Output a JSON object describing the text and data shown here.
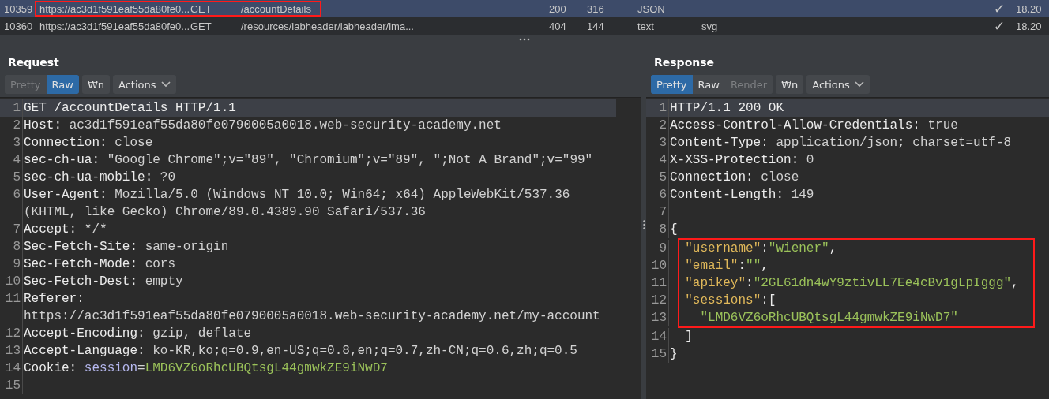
{
  "history": {
    "rows": [
      {
        "cells": [
          "10359",
          "https://ac3d1f591eaf55da80fe0...",
          "GET",
          "/accountDetails",
          "200",
          "316",
          "JSON",
          "",
          "✓",
          "18.20"
        ],
        "selected": true,
        "annotated": true
      },
      {
        "cells": [
          "10360",
          "https://ac3d1f591eaf55da80fe0...",
          "GET",
          "/resources/labheader/labheader/ima...",
          "404",
          "144",
          "text",
          "svg",
          "✓",
          "18.20"
        ],
        "selected": false,
        "annotated": false
      }
    ]
  },
  "panes": [
    {
      "title": "Request",
      "buttons": [
        {
          "label": "Pretty",
          "kind": "tab",
          "selected": false,
          "disabled": true
        },
        {
          "label": "Raw",
          "kind": "tab",
          "selected": true,
          "disabled": false
        },
        {
          "label": "₩n",
          "kind": "toggle",
          "selected": false,
          "disabled": false
        },
        {
          "label": "Actions",
          "kind": "menu",
          "selected": false,
          "disabled": false
        }
      ],
      "lines": [
        {
          "number": "1",
          "current": true,
          "annotated": false,
          "parts": [
            {
              "kind": "key",
              "text": "GET /accountDetails HTTP/1.1"
            }
          ]
        },
        {
          "number": "2",
          "current": false,
          "annotated": false,
          "parts": [
            {
              "kind": "key",
              "text": "Host: "
            },
            {
              "kind": "value",
              "text": "ac3d1f591eaf55da80fe0790005a0018.web-security-academy.net"
            }
          ]
        },
        {
          "number": "3",
          "current": false,
          "annotated": false,
          "parts": [
            {
              "kind": "key",
              "text": "Connection: "
            },
            {
              "kind": "value",
              "text": "close"
            }
          ]
        },
        {
          "number": "4",
          "current": false,
          "annotated": false,
          "parts": [
            {
              "kind": "key",
              "text": "sec-ch-ua: "
            },
            {
              "kind": "value",
              "text": "\"Google Chrome\";v=\"89\", \"Chromium\";v=\"89\", \";Not A Brand\";v=\"99\""
            }
          ]
        },
        {
          "number": "5",
          "current": false,
          "annotated": false,
          "parts": [
            {
              "kind": "key",
              "text": "sec-ch-ua-mobile: "
            },
            {
              "kind": "value",
              "text": "?0"
            }
          ]
        },
        {
          "number": "6",
          "current": false,
          "annotated": false,
          "parts": [
            {
              "kind": "key",
              "text": "User-Agent: "
            },
            {
              "kind": "value",
              "text": "Mozilla/5.0 (Windows NT 10.0; Win64; x64) AppleWebKit/537.36 (KHTML, like Gecko) Chrome/89.0.4389.90 Safari/537.36"
            }
          ]
        },
        {
          "number": "7",
          "current": false,
          "annotated": false,
          "parts": [
            {
              "kind": "key",
              "text": "Accept: "
            },
            {
              "kind": "value",
              "text": "*/*"
            }
          ]
        },
        {
          "number": "8",
          "current": false,
          "annotated": false,
          "parts": [
            {
              "kind": "key",
              "text": "Sec-Fetch-Site: "
            },
            {
              "kind": "value",
              "text": "same-origin"
            }
          ]
        },
        {
          "number": "9",
          "current": false,
          "annotated": false,
          "parts": [
            {
              "kind": "key",
              "text": "Sec-Fetch-Mode: "
            },
            {
              "kind": "value",
              "text": "cors"
            }
          ]
        },
        {
          "number": "10",
          "current": false,
          "annotated": false,
          "parts": [
            {
              "kind": "key",
              "text": "Sec-Fetch-Dest: "
            },
            {
              "kind": "value",
              "text": "empty"
            }
          ]
        },
        {
          "number": "11",
          "current": false,
          "annotated": false,
          "parts": [
            {
              "kind": "key",
              "text": "Referer: "
            },
            {
              "kind": "value",
              "text": "https://ac3d1f591eaf55da80fe0790005a0018.web-security-academy.net/my-account"
            }
          ]
        },
        {
          "number": "12",
          "current": false,
          "annotated": false,
          "parts": [
            {
              "kind": "key",
              "text": "Accept-Encoding: "
            },
            {
              "kind": "value",
              "text": "gzip, deflate"
            }
          ]
        },
        {
          "number": "13",
          "current": false,
          "annotated": false,
          "parts": [
            {
              "kind": "key",
              "text": "Accept-Language: "
            },
            {
              "kind": "value",
              "text": "ko-KR,ko;q=0.9,en-US;q=0.8,en;q=0.7,zh-CN;q=0.6,zh;q=0.5"
            }
          ]
        },
        {
          "number": "14",
          "current": false,
          "annotated": false,
          "parts": [
            {
              "kind": "key",
              "text": "Cookie: "
            },
            {
              "kind": "param",
              "text": "session"
            },
            {
              "kind": "value",
              "text": "="
            },
            {
              "kind": "string",
              "text": "LMD6VZ6oRhcUBQtsgL44gmwkZE9iNwD7"
            }
          ]
        },
        {
          "number": "15",
          "current": false,
          "annotated": false
        }
      ]
    },
    {
      "title": "Response",
      "buttons": [
        {
          "label": "Pretty",
          "kind": "tab",
          "selected": true,
          "disabled": false
        },
        {
          "label": "Raw",
          "kind": "tab",
          "selected": false,
          "disabled": false
        },
        {
          "label": "Render",
          "kind": "tab",
          "selected": false,
          "disabled": true
        },
        {
          "label": "₩n",
          "kind": "toggle",
          "selected": false,
          "disabled": false
        },
        {
          "label": "Actions",
          "kind": "menu",
          "selected": false,
          "disabled": false
        }
      ],
      "lines": [
        {
          "number": "1",
          "current": true,
          "annotated": false,
          "parts": [
            {
              "kind": "key",
              "text": "HTTP/1.1 200 OK"
            }
          ]
        },
        {
          "number": "2",
          "current": false,
          "annotated": false,
          "parts": [
            {
              "kind": "key",
              "text": "Access-Control-Allow-Credentials: "
            },
            {
              "kind": "value",
              "text": "true"
            }
          ]
        },
        {
          "number": "3",
          "current": false,
          "annotated": false,
          "parts": [
            {
              "kind": "key",
              "text": "Content-Type: "
            },
            {
              "kind": "value",
              "text": "application/json; charset=utf-8"
            }
          ]
        },
        {
          "number": "4",
          "current": false,
          "annotated": false,
          "parts": [
            {
              "kind": "key",
              "text": "X-XSS-Protection: "
            },
            {
              "kind": "value",
              "text": "0"
            }
          ]
        },
        {
          "number": "5",
          "current": false,
          "annotated": false,
          "parts": [
            {
              "kind": "key",
              "text": "Connection: "
            },
            {
              "kind": "value",
              "text": "close"
            }
          ]
        },
        {
          "number": "6",
          "current": false,
          "annotated": false,
          "parts": [
            {
              "kind": "key",
              "text": "Content-Length: "
            },
            {
              "kind": "value",
              "text": "149"
            }
          ]
        },
        {
          "number": "7",
          "current": false,
          "annotated": false
        },
        {
          "number": "8",
          "current": false,
          "annotated": false,
          "parts": [
            {
              "kind": "key",
              "text": "{"
            }
          ]
        },
        {
          "number": "9",
          "current": false,
          "annotated": true,
          "parts": [
            {
              "kind": "jkey",
              "text": "  \"username\""
            },
            {
              "kind": "key",
              "text": ":"
            },
            {
              "kind": "string",
              "text": "\"wiener\""
            },
            {
              "kind": "key",
              "text": ","
            }
          ]
        },
        {
          "number": "10",
          "current": false,
          "annotated": true,
          "parts": [
            {
              "kind": "jkey",
              "text": "  \"email\""
            },
            {
              "kind": "key",
              "text": ":"
            },
            {
              "kind": "string",
              "text": "\"\""
            },
            {
              "kind": "key",
              "text": ","
            }
          ]
        },
        {
          "number": "11",
          "current": false,
          "annotated": true,
          "parts": [
            {
              "kind": "jkey",
              "text": "  \"apikey\""
            },
            {
              "kind": "key",
              "text": ":"
            },
            {
              "kind": "string",
              "text": "\"2GL61dn4wY9ztivLL7Ee4cBv1gLpIggg\""
            },
            {
              "kind": "key",
              "text": ","
            }
          ]
        },
        {
          "number": "12",
          "current": false,
          "annotated": true,
          "parts": [
            {
              "kind": "jkey",
              "text": "  \"sessions\""
            },
            {
              "kind": "key",
              "text": ":["
            }
          ]
        },
        {
          "number": "13",
          "current": false,
          "annotated": true,
          "parts": [
            {
              "kind": "string",
              "text": "    \"LMD6VZ6oRhcUBQtsgL44gmwkZE9iNwD7\""
            }
          ]
        },
        {
          "number": "14",
          "current": false,
          "annotated": false,
          "parts": [
            {
              "kind": "key",
              "text": "  ]"
            }
          ]
        },
        {
          "number": "15",
          "current": false,
          "annotated": false,
          "parts": [
            {
              "kind": "key",
              "text": "}"
            }
          ]
        }
      ]
    }
  ]
}
